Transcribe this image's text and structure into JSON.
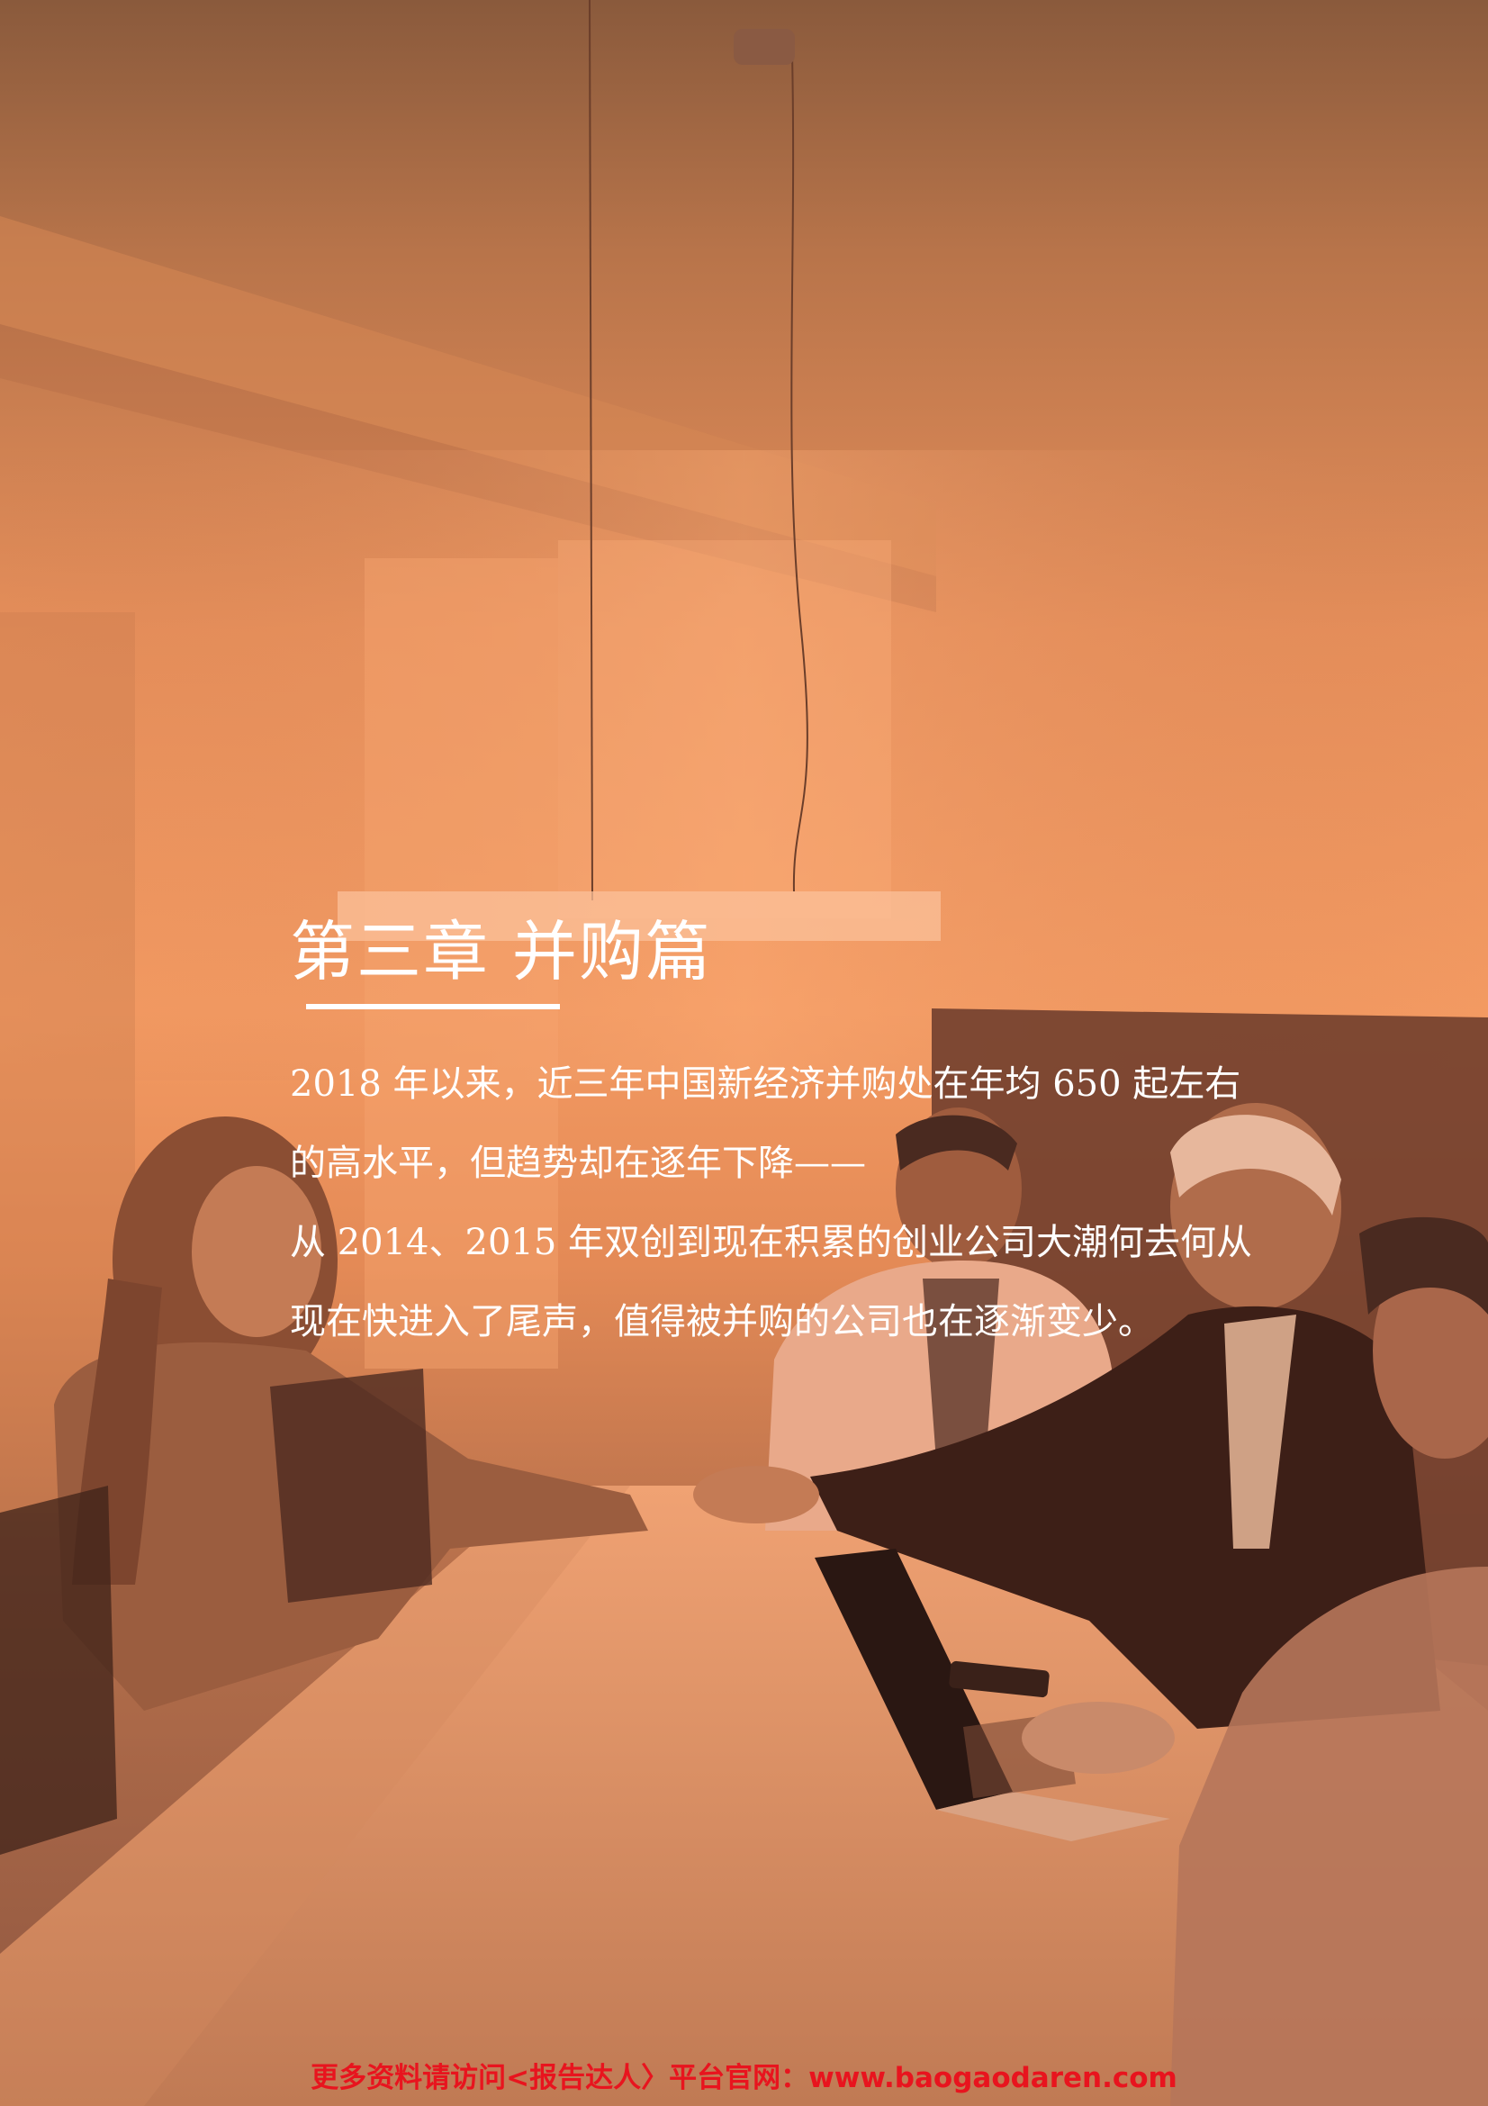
{
  "chapter": {
    "title": "第三章  并购篇",
    "paragraph_lines": [
      "2018 年以来，近三年中国新经济并购处在年均 650 起左右",
      "的高水平，但趋势却在逐年下降——",
      "从 2014、2015 年双创到现在积累的创业公司大潮何去何从",
      "现在快进入了尾声，值得被并购的公司也在逐渐变少。"
    ]
  },
  "footer": {
    "note": "更多资料请访问<报告达人〉平台官网：www.baogaodaren.com"
  },
  "colors": {
    "overlay": "#f2955f",
    "title_text": "#ffffff",
    "footer_text": "#e8141e"
  }
}
